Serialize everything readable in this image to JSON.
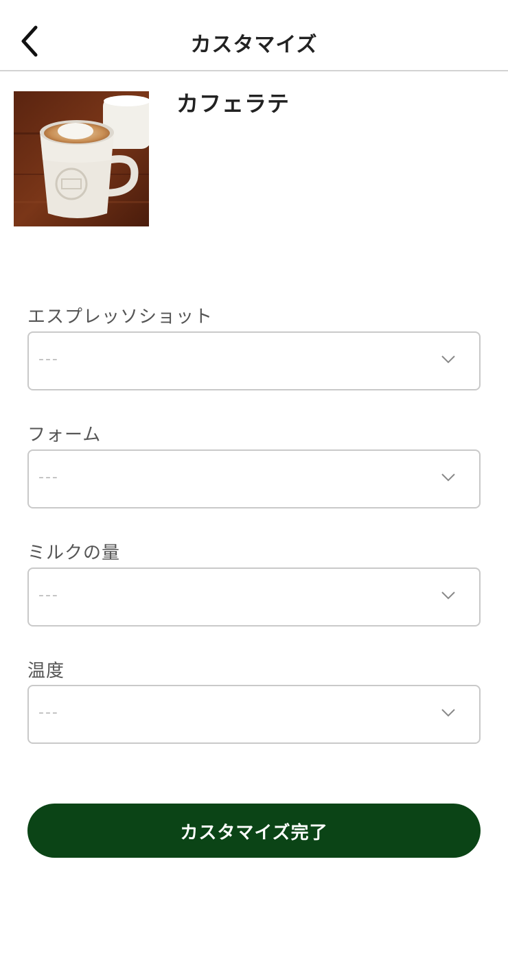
{
  "header": {
    "title": "カスタマイズ",
    "back_icon": "chevron-left-icon"
  },
  "product": {
    "name": "カフェラテ",
    "image": "cafe-latte-photo"
  },
  "fields": [
    {
      "label": "エスプレッソショット",
      "value": "---"
    },
    {
      "label": "フォーム",
      "value": "---"
    },
    {
      "label": "ミルクの量",
      "value": "---"
    },
    {
      "label": "温度",
      "value": "---"
    }
  ],
  "footer": {
    "done_label": "カスタマイズ完了"
  },
  "colors": {
    "primary_button": "#0b4416",
    "placeholder": "#bdbdbd",
    "border": "#c9c9c9"
  }
}
